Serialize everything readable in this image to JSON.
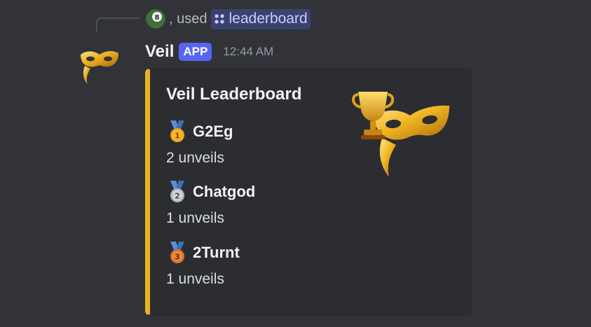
{
  "reply": {
    "used_label": ", used",
    "command_name": "leaderboard"
  },
  "message": {
    "username": "Veil",
    "badge": "APP",
    "timestamp": "12:44 AM"
  },
  "embed": {
    "title": "Veil Leaderboard",
    "accent_color": "#e9b321",
    "entries": [
      {
        "medal": "first-place-medal-icon",
        "name": "G2Eg",
        "count": "2 unveils"
      },
      {
        "medal": "second-place-medal-icon",
        "name": "Chatgod",
        "count": "1 unveils"
      },
      {
        "medal": "third-place-medal-icon",
        "name": "2Turnt",
        "count": "1 unveils"
      }
    ]
  },
  "colors": {
    "background": "#313338",
    "embed_bg": "#2b2d31",
    "app_badge": "#5865f2",
    "command_chip": "#3c4270"
  }
}
